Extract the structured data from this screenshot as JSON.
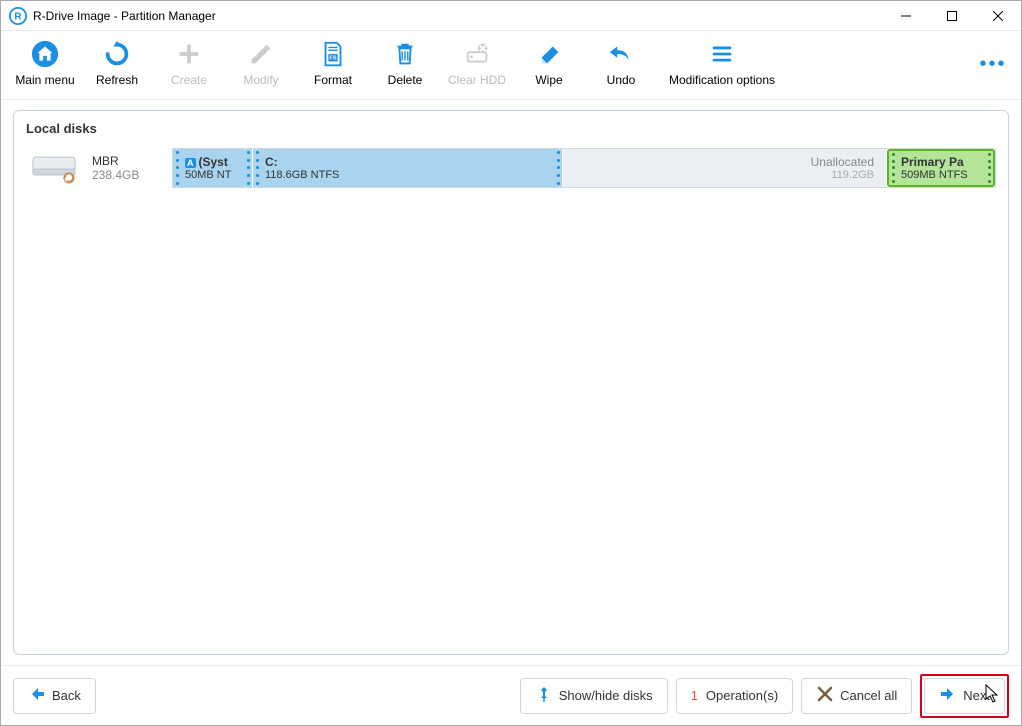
{
  "window": {
    "title": "R-Drive Image - Partition Manager"
  },
  "toolbar": {
    "main_menu": "Main menu",
    "refresh": "Refresh",
    "create": "Create",
    "modify": "Modify",
    "format": "Format",
    "delete": "Delete",
    "clear_hdd": "Clear HDD",
    "wipe": "Wipe",
    "undo": "Undo",
    "mod_options": "Modification options"
  },
  "panel": {
    "title": "Local disks"
  },
  "disk": {
    "scheme": "MBR",
    "size": "238.4GB",
    "parts": [
      {
        "name": "(Syst",
        "size": "50MB NT",
        "badge": "A"
      },
      {
        "name": "C:",
        "size": "118.6GB NTFS"
      },
      {
        "name": "Unallocated",
        "size": "119.2GB"
      },
      {
        "name": "Primary Pa",
        "size": "509MB NTFS"
      }
    ]
  },
  "footer": {
    "back": "Back",
    "show_hide": "Show/hide disks",
    "ops_count": "1",
    "ops_label": "Operation(s)",
    "cancel_all": "Cancel all",
    "next": "Next"
  }
}
